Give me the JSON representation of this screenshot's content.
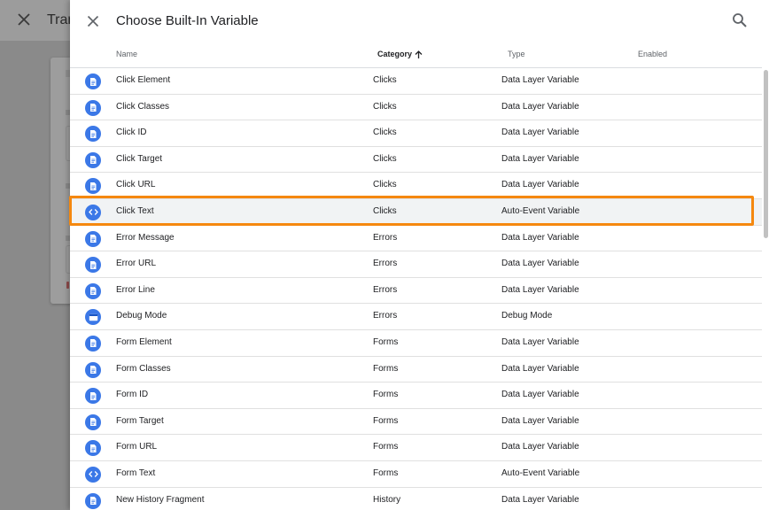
{
  "background": {
    "title": "Tran"
  },
  "dialog": {
    "title": "Choose Built-In Variable"
  },
  "columns": {
    "name": "Name",
    "category": "Category",
    "type": "Type",
    "enabled": "Enabled",
    "sorted_by": "Category",
    "sort_direction": "ascending"
  },
  "rows": [
    {
      "name": "Click Element",
      "category": "Clicks",
      "type": "Data Layer Variable",
      "icon": "document-icon"
    },
    {
      "name": "Click Classes",
      "category": "Clicks",
      "type": "Data Layer Variable",
      "icon": "document-icon"
    },
    {
      "name": "Click ID",
      "category": "Clicks",
      "type": "Data Layer Variable",
      "icon": "document-icon"
    },
    {
      "name": "Click Target",
      "category": "Clicks",
      "type": "Data Layer Variable",
      "icon": "document-icon"
    },
    {
      "name": "Click URL",
      "category": "Clicks",
      "type": "Data Layer Variable",
      "icon": "document-icon"
    },
    {
      "name": "Click Text",
      "category": "Clicks",
      "type": "Auto-Event Variable",
      "icon": "code-icon",
      "highlighted": true
    },
    {
      "name": "Error Message",
      "category": "Errors",
      "type": "Data Layer Variable",
      "icon": "document-icon"
    },
    {
      "name": "Error URL",
      "category": "Errors",
      "type": "Data Layer Variable",
      "icon": "document-icon"
    },
    {
      "name": "Error Line",
      "category": "Errors",
      "type": "Data Layer Variable",
      "icon": "document-icon"
    },
    {
      "name": "Debug Mode",
      "category": "Errors",
      "type": "Debug Mode",
      "icon": "window-icon"
    },
    {
      "name": "Form Element",
      "category": "Forms",
      "type": "Data Layer Variable",
      "icon": "document-icon"
    },
    {
      "name": "Form Classes",
      "category": "Forms",
      "type": "Data Layer Variable",
      "icon": "document-icon"
    },
    {
      "name": "Form ID",
      "category": "Forms",
      "type": "Data Layer Variable",
      "icon": "document-icon"
    },
    {
      "name": "Form Target",
      "category": "Forms",
      "type": "Data Layer Variable",
      "icon": "document-icon"
    },
    {
      "name": "Form URL",
      "category": "Forms",
      "type": "Data Layer Variable",
      "icon": "document-icon"
    },
    {
      "name": "Form Text",
      "category": "Forms",
      "type": "Auto-Event Variable",
      "icon": "code-icon"
    },
    {
      "name": "New History Fragment",
      "category": "History",
      "type": "Data Layer Variable",
      "icon": "document-icon"
    }
  ],
  "colors": {
    "icon_blue": "#3b78e7",
    "highlight_border": "#f5880f",
    "highlight_row": "#f1f3f4"
  }
}
